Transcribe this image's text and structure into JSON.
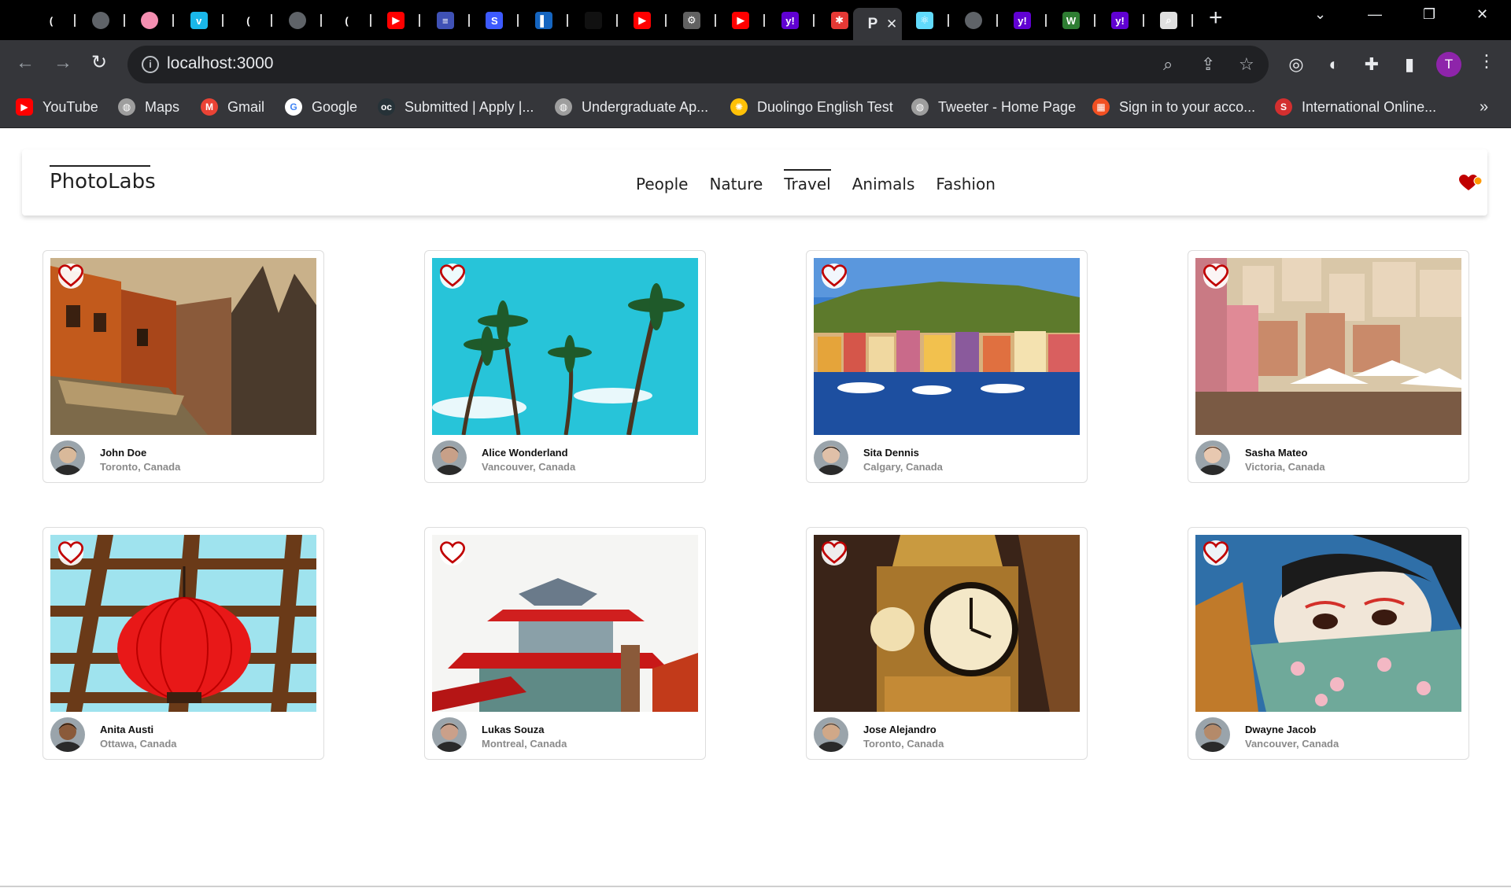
{
  "browser": {
    "url": "localhost:3000",
    "active_tab_letter": "P",
    "profile_initial": "T",
    "tabs": [
      {
        "icon": "dark-circle-icon",
        "color": "#000000",
        "glyph": "("
      },
      {
        "icon": "globe-icon",
        "color": "#5f6368",
        "glyph": ""
      },
      {
        "icon": "pink-circle-icon",
        "color": "#f48fb1",
        "glyph": ""
      },
      {
        "icon": "vimeo-icon",
        "color": "#1ab7ea",
        "glyph": "v"
      },
      {
        "icon": "dark-circle-icon",
        "color": "#000000",
        "glyph": "("
      },
      {
        "icon": "globe-icon",
        "color": "#5f6368",
        "glyph": ""
      },
      {
        "icon": "dark-circle-icon",
        "color": "#000000",
        "glyph": "("
      },
      {
        "icon": "youtube-icon",
        "color": "#ff0000",
        "glyph": "▶"
      },
      {
        "icon": "stripes-icon",
        "color": "#3f51b5",
        "glyph": "≡"
      },
      {
        "icon": "swirl-icon",
        "color": "#3d5afe",
        "glyph": "S"
      },
      {
        "icon": "blue-square-icon",
        "color": "#1565c0",
        "glyph": "▌"
      },
      {
        "icon": "dark-square-icon",
        "color": "#111111",
        "glyph": ""
      },
      {
        "icon": "youtube-icon",
        "color": "#ff0000",
        "glyph": "▶"
      },
      {
        "icon": "gear-app-icon",
        "color": "#616161",
        "glyph": "⚙"
      },
      {
        "icon": "youtube-icon",
        "color": "#ff0000",
        "glyph": "▶"
      },
      {
        "icon": "yahoo-icon",
        "color": "#6001d2",
        "glyph": "y!"
      },
      {
        "icon": "asterisk-icon",
        "color": "#e53935",
        "glyph": "✱"
      }
    ],
    "tabs_right": [
      {
        "icon": "react-icon",
        "color": "#61dafb",
        "glyph": "⚛"
      },
      {
        "icon": "globe-icon",
        "color": "#5f6368",
        "glyph": ""
      },
      {
        "icon": "yahoo-icon",
        "color": "#6001d2",
        "glyph": "y!"
      },
      {
        "icon": "w-icon",
        "color": "#2e7d32",
        "glyph": "W"
      },
      {
        "icon": "yahoo-icon",
        "color": "#6001d2",
        "glyph": "y!"
      },
      {
        "icon": "search-doc-icon",
        "color": "#e0e0e0",
        "glyph": "⌕"
      }
    ],
    "bookmarks": [
      {
        "label": "YouTube",
        "icon": "youtube-icon",
        "color": "#ff0000",
        "glyph": "▶"
      },
      {
        "label": "Maps",
        "icon": "globe-icon",
        "color": "#9e9e9e",
        "glyph": "◍"
      },
      {
        "label": "Gmail",
        "icon": "gmail-icon",
        "color": "#ea4335",
        "glyph": "M"
      },
      {
        "label": "Google",
        "icon": "google-icon",
        "color": "#ffffff",
        "glyph": "G"
      },
      {
        "label": "Submitted | Apply |...",
        "icon": "oc-icon",
        "color": "#263238",
        "glyph": "oc"
      },
      {
        "label": "Undergraduate Ap...",
        "icon": "globe-icon",
        "color": "#9e9e9e",
        "glyph": "◍"
      },
      {
        "label": "Duolingo English Test",
        "icon": "duolingo-icon",
        "color": "#ffc107",
        "glyph": "✺"
      },
      {
        "label": "Tweeter - Home Page",
        "icon": "globe-icon",
        "color": "#9e9e9e",
        "glyph": "◍"
      },
      {
        "label": "Sign in to your acco...",
        "icon": "microsoft-icon",
        "color": "#f25022",
        "glyph": "▦"
      },
      {
        "label": "International Online...",
        "icon": "s-icon",
        "color": "#d32f2f",
        "glyph": "S"
      }
    ]
  },
  "app": {
    "logo": "PhotoLabs",
    "topics": [
      "People",
      "Nature",
      "Travel",
      "Animals",
      "Fashion"
    ],
    "current_topic": "Travel",
    "favorites_notification": true,
    "accent": "#c00000"
  },
  "photos": [
    {
      "user": "John Doe",
      "location": "Toronto, Canada",
      "scene": "old-city-buildings"
    },
    {
      "user": "Alice Wonderland",
      "location": "Vancouver, Canada",
      "scene": "palm-trees"
    },
    {
      "user": "Sita Dennis",
      "location": "Calgary, Canada",
      "scene": "colorful-harbor"
    },
    {
      "user": "Sasha Mateo",
      "location": "Victoria, Canada",
      "scene": "hillside-cafe"
    },
    {
      "user": "Anita Austi",
      "location": "Ottawa, Canada",
      "scene": "red-lantern"
    },
    {
      "user": "Lukas Souza",
      "location": "Montreal, Canada",
      "scene": "pagoda-roof"
    },
    {
      "user": "Jose Alejandro",
      "location": "Toronto, Canada",
      "scene": "clock-tower"
    },
    {
      "user": "Dwayne Jacob",
      "location": "Vancouver, Canada",
      "scene": "geisha-mural"
    }
  ]
}
